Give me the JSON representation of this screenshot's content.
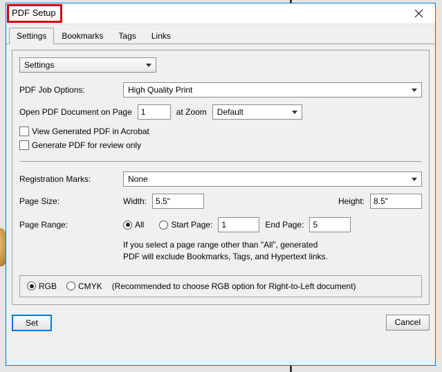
{
  "dialog": {
    "title": "PDF Setup"
  },
  "tabs": [
    "Settings",
    "Bookmarks",
    "Tags",
    "Links"
  ],
  "section_selector": "Settings",
  "job_options": {
    "label": "PDF Job Options:",
    "value": "High Quality Print"
  },
  "open_page": {
    "label": "Open PDF Document on Page",
    "value": "1",
    "zoom_label": "at Zoom",
    "zoom_value": "Default"
  },
  "checkboxes": {
    "view_acrobat": "View Generated PDF in Acrobat",
    "review_only": "Generate PDF for review only"
  },
  "reg_marks": {
    "label": "Registration Marks:",
    "value": "None"
  },
  "page_size": {
    "label": "Page Size:",
    "width_label": "Width:",
    "width_value": "5.5\"",
    "height_label": "Height:",
    "height_value": "8.5\""
  },
  "page_range": {
    "label": "Page Range:",
    "all_label": "All",
    "start_label": "Start Page:",
    "start_value": "1",
    "end_label": "End Page:",
    "end_value": "5",
    "note_line1": "If you select a page range other than \"All\",  generated",
    "note_line2": "PDF will exclude Bookmarks, Tags, and Hypertext links."
  },
  "color_mode": {
    "rgb": "RGB",
    "cmyk": "CMYK",
    "note": "(Recommended to choose RGB option for Right-to-Left document)"
  },
  "buttons": {
    "set": "Set",
    "cancel": "Cancel"
  }
}
